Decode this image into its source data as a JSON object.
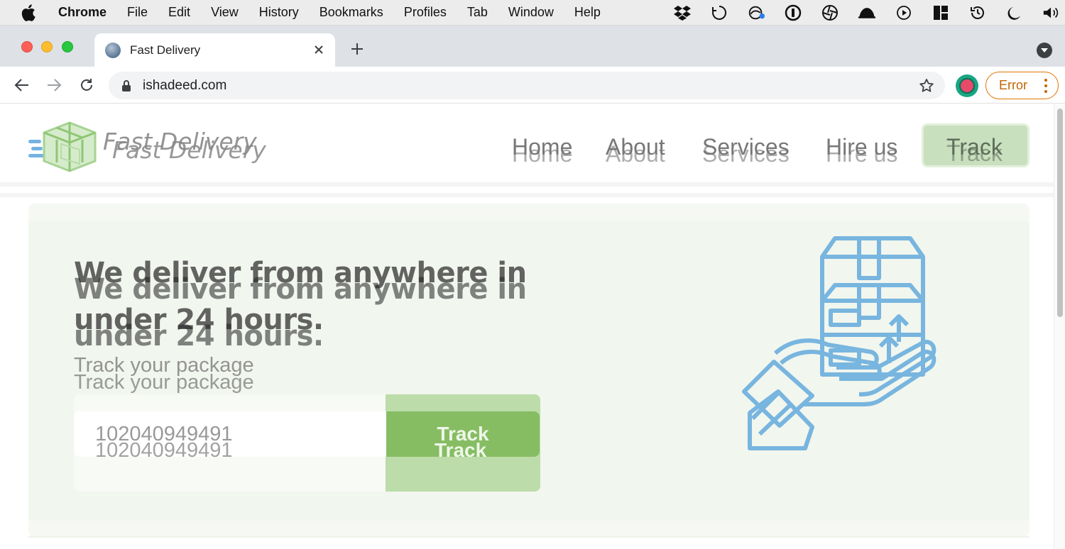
{
  "menubar": {
    "app_name": "Chrome",
    "items": [
      "File",
      "Edit",
      "View",
      "History",
      "Bookmarks",
      "Profiles",
      "Tab",
      "Window",
      "Help"
    ]
  },
  "browser": {
    "tab_title": "Fast Delivery",
    "url": "ishadeed.com",
    "error_label": "Error"
  },
  "site": {
    "logo_text": "Fast Delivery",
    "nav": [
      "Home",
      "About",
      "Services",
      "Hire us"
    ],
    "nav_cta": "Track"
  },
  "hero": {
    "headline_line1": "We deliver from anywhere in",
    "headline_line2": "under 24 hours.",
    "subheading": "Track your package",
    "input_value": "102040949491",
    "button_label": "Track"
  },
  "colors": {
    "accent_green": "#86bd63",
    "hero_background": "#f1f6ee",
    "illustration_blue": "#5aa5dc",
    "error_orange": "#e37400"
  }
}
